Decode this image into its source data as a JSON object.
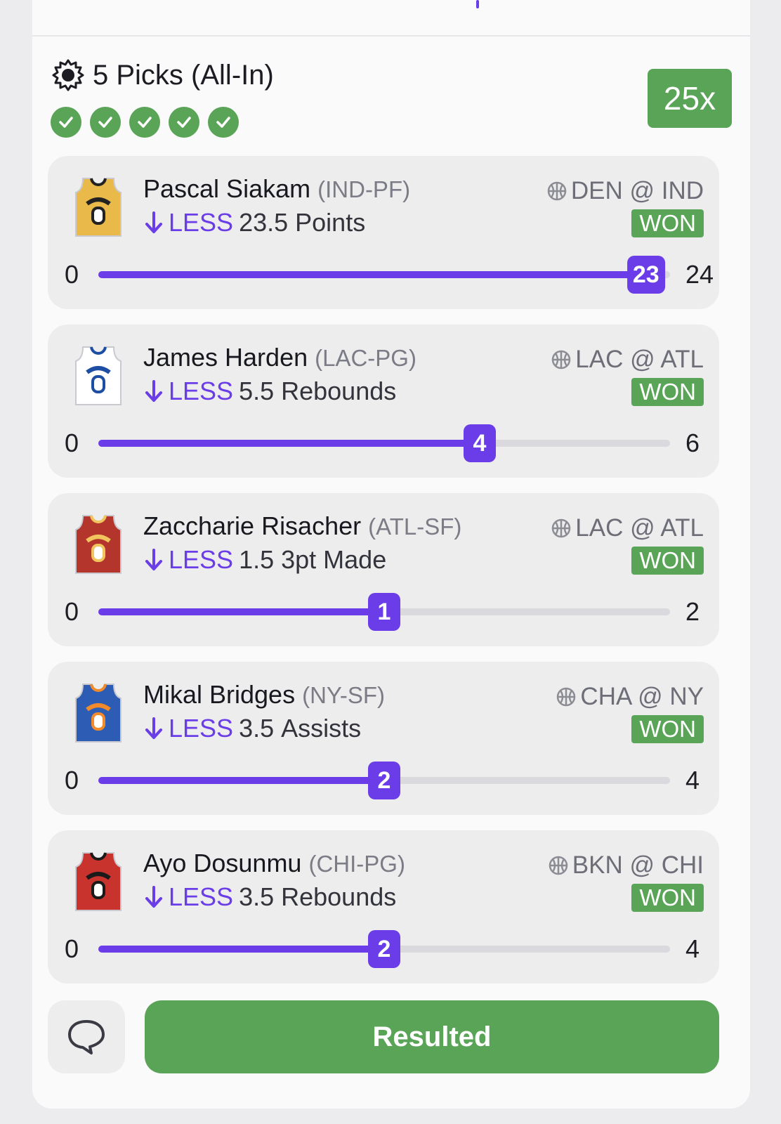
{
  "header": {
    "title": "5 Picks (All-In)",
    "multiplier": "25x",
    "checks": 5
  },
  "colors": {
    "accent": "#6a3de8",
    "won": "#5aa457",
    "card": "#ededee",
    "track": "#dadade"
  },
  "picks": [
    {
      "name": "Pascal Siakam",
      "pos": "(IND-PF)",
      "direction": "LESS",
      "line": "23.5",
      "stat": "Points",
      "matchup": "DEN @ IND",
      "result": "WON",
      "min": "0",
      "max": "24",
      "current": "23",
      "progress": 0.958,
      "jersey": {
        "main": "#e9b94a",
        "trim": "#222222",
        "icon": "jersey-ind-icon"
      }
    },
    {
      "name": "James Harden",
      "pos": "(LAC-PG)",
      "direction": "LESS",
      "line": "5.5",
      "stat": "Rebounds",
      "matchup": "LAC @ ATL",
      "result": "WON",
      "min": "0",
      "max": "6",
      "current": "4",
      "progress": 0.667,
      "jersey": {
        "main": "#ffffff",
        "trim": "#1e4ea3",
        "icon": "jersey-lac-icon"
      }
    },
    {
      "name": "Zaccharie Risacher",
      "pos": "(ATL-SF)",
      "direction": "LESS",
      "line": "1.5",
      "stat": "3pt Made",
      "matchup": "LAC @ ATL",
      "result": "WON",
      "min": "0",
      "max": "2",
      "current": "1",
      "progress": 0.5,
      "jersey": {
        "main": "#b3352b",
        "trim": "#f1c45d",
        "icon": "jersey-atl-icon"
      }
    },
    {
      "name": "Mikal Bridges",
      "pos": "(NY-SF)",
      "direction": "LESS",
      "line": "3.5",
      "stat": "Assists",
      "matchup": "CHA @ NY",
      "result": "WON",
      "min": "0",
      "max": "4",
      "current": "2",
      "progress": 0.5,
      "jersey": {
        "main": "#2c5cb3",
        "trim": "#f08a2b",
        "icon": "jersey-ny-icon"
      }
    },
    {
      "name": "Ayo Dosunmu",
      "pos": "(CHI-PG)",
      "direction": "LESS",
      "line": "3.5",
      "stat": "Rebounds",
      "matchup": "BKN @ CHI",
      "result": "WON",
      "min": "0",
      "max": "4",
      "current": "2",
      "progress": 0.5,
      "jersey": {
        "main": "#c9332e",
        "trim": "#1a1a1a",
        "icon": "jersey-chi-icon"
      }
    }
  ],
  "footer": {
    "chat_icon": "chat-bubble-icon",
    "status_label": "Resulted"
  }
}
